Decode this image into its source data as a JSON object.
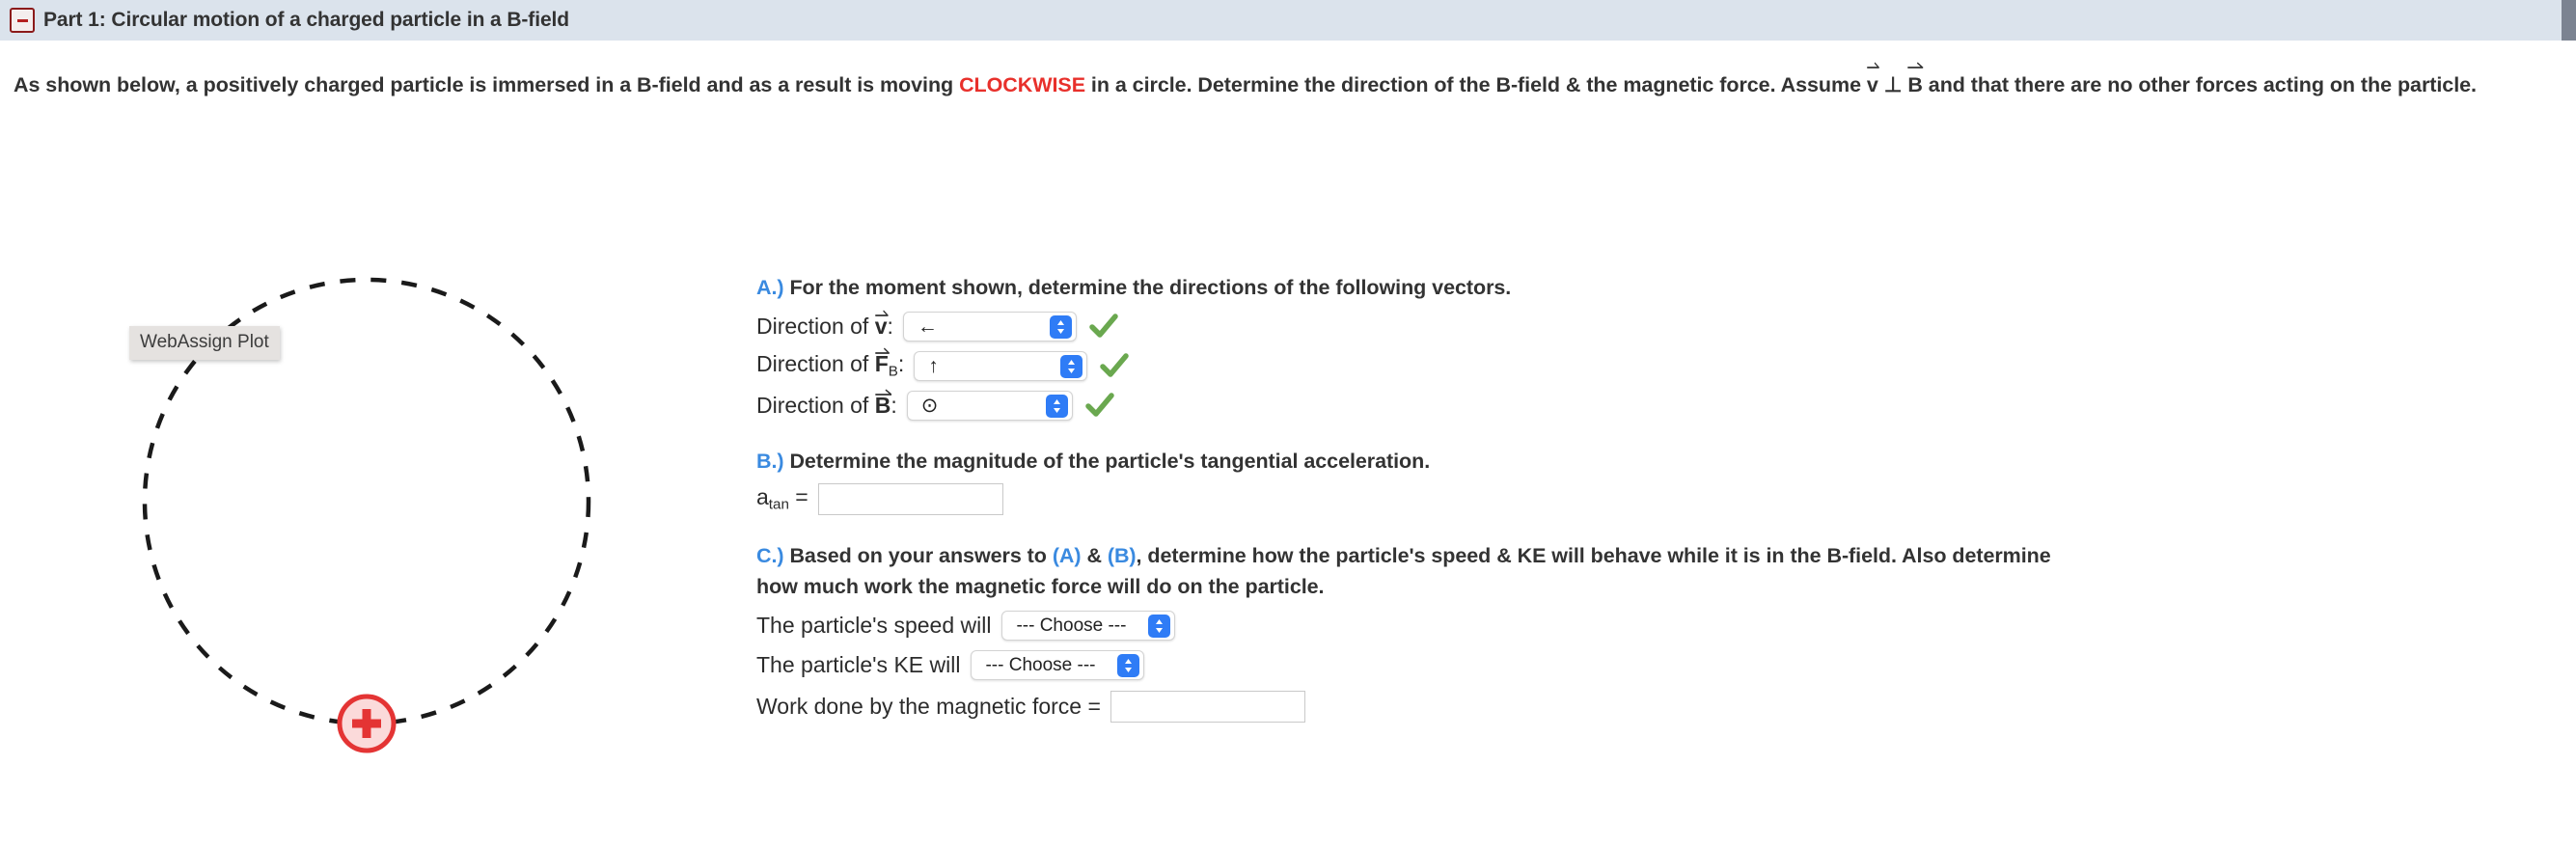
{
  "header": {
    "title": "Part 1: Circular motion of a charged particle in a B-field",
    "collapse_icon": "minus-box-icon",
    "background_color": "#dbe3ec"
  },
  "intro": {
    "segment_1": "As shown below, a positively charged particle is immersed in a B-field and as a result is moving ",
    "emphasis": "CLOCKWISE",
    "emphasis_color": "#e8302b",
    "segment_2": " in a circle. Determine the direction of the B-field & the magnetic force. Assume ",
    "vector_v": "v",
    "perp_symbol": "⊥",
    "vector_b": "B",
    "segment_3": " and that there are no other forces acting on the particle."
  },
  "figure": {
    "plot_label": "WebAssign Plot",
    "particle_sign": "+",
    "particle_stroke_color": "#e43434",
    "particle_fill_color": "#fbdada",
    "orbit_style": "dashed-circle",
    "orbit_color": "#1a1a1a"
  },
  "questions": {
    "a": {
      "letter": "A.)",
      "prompt": "For the moment shown, determine the directions of the following vectors.",
      "rows": [
        {
          "label_prefix": "Direction of ",
          "vector": "v",
          "subscript": "",
          "label_suffix": ":",
          "value": "←",
          "status": "correct"
        },
        {
          "label_prefix": "Direction of ",
          "vector": "F",
          "subscript": "B",
          "label_suffix": ":",
          "value": "↑",
          "status": "correct"
        },
        {
          "label_prefix": "Direction of ",
          "vector": "B",
          "subscript": "",
          "label_suffix": ":",
          "value": "⊙",
          "status": "correct"
        }
      ]
    },
    "b": {
      "letter": "B.)",
      "prompt": "Determine the magnitude of the particle's tangential acceleration.",
      "field_label": "a",
      "field_label_sub": "tan",
      "equals": "=",
      "value": "",
      "placeholder": ""
    },
    "c": {
      "letter": "C.)",
      "prompt_part_1": "Based on your answers to ",
      "ref_a": "(A)",
      "amp": " & ",
      "ref_b": "(B)",
      "prompt_part_2": ", determine how the particle's speed & KE will behave while it is in the B-field. Also determine how much work the magnetic force will do on the particle.",
      "rows": [
        {
          "label": "The particle's speed will",
          "value": "--- Choose ---"
        },
        {
          "label": "The particle's KE will",
          "value": "--- Choose ---"
        }
      ],
      "work_label": "Work done by the magnetic force  =",
      "work_value": "",
      "work_placeholder": ""
    }
  },
  "colors": {
    "accent_blue": "#3a8ae0",
    "stepper_blue": "#2f7cf6",
    "check_green": "#6aa84f",
    "text": "#333333"
  }
}
